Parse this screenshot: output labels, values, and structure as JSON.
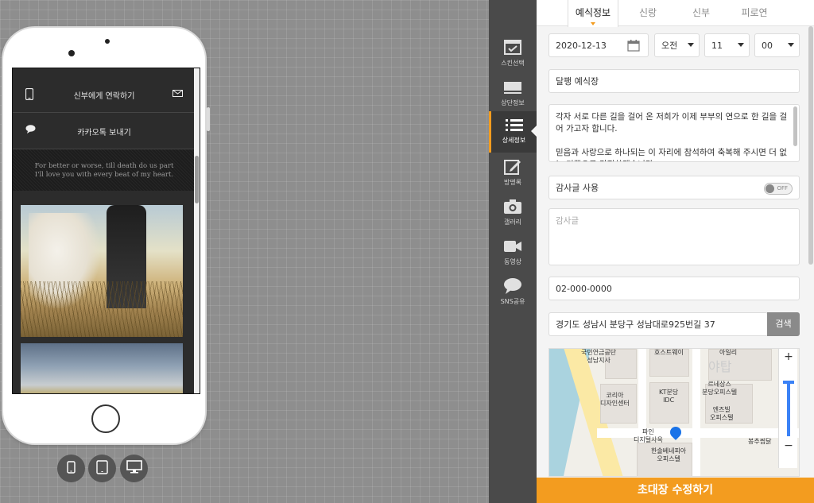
{
  "preview": {
    "contact_bride": "신부에게 연락하기",
    "kakao_send": "카카오톡 보내기",
    "quote_line1": "For better or worse, till death do us part",
    "quote_line2": "I'll love you with every beat of my heart."
  },
  "device_buttons": [
    "mobile-icon",
    "tablet-icon",
    "desktop-icon"
  ],
  "sidenav": {
    "items": [
      {
        "label": "스킨선택",
        "icon": "skin-icon"
      },
      {
        "label": "상단정보",
        "icon": "header-icon"
      },
      {
        "label": "상세정보",
        "icon": "list-icon",
        "active": true
      },
      {
        "label": "방명록",
        "icon": "edit-icon"
      },
      {
        "label": "갤러리",
        "icon": "camera-icon"
      },
      {
        "label": "동영상",
        "icon": "video-icon"
      },
      {
        "label": "SNS공유",
        "icon": "chat-icon"
      }
    ]
  },
  "tabs": [
    "예식정보",
    "신랑",
    "신부",
    "피로연"
  ],
  "form": {
    "date": "2020-12-13",
    "ampm": "오전",
    "hour": "11",
    "minute": "00",
    "venue": "달팽 예식장",
    "message": "각자 서로 다른 길을 걸어 온 저희가 이제 부부의 연으로 한 길을 걸어 가고자 합니다.\n\n믿음과 사랑으로 하나되는 이 자리에 참석하여 축복해 주시면 더 없는 기쁨으로 간직하겠습니다.",
    "thanks_label": "감사글 사용",
    "toggle_state": "OFF",
    "thanks_placeholder": "감사글",
    "phone": "02-000-0000",
    "address": "경기도 성남시 분당구 성남대로925번길 37",
    "search_label": "검색"
  },
  "map": {
    "labels": [
      "국민연금공단\n성남지사",
      "호스트웨이",
      "아일리",
      "코리아\n디자인센터",
      "KT분당\nIDC",
      "르네상스\n분당오피스텔",
      "엔즈빌\n오피스텔",
      "파인\n디지털사옥",
      "한솔베네피아\n오피스텔",
      "봉추찜닭",
      "야탑"
    ],
    "zoom_in": "+",
    "zoom_out": "−"
  },
  "submit_label": "초대장 수정하기",
  "colors": {
    "accent": "#f39c1f",
    "nav_bg": "#4a4a4a"
  }
}
